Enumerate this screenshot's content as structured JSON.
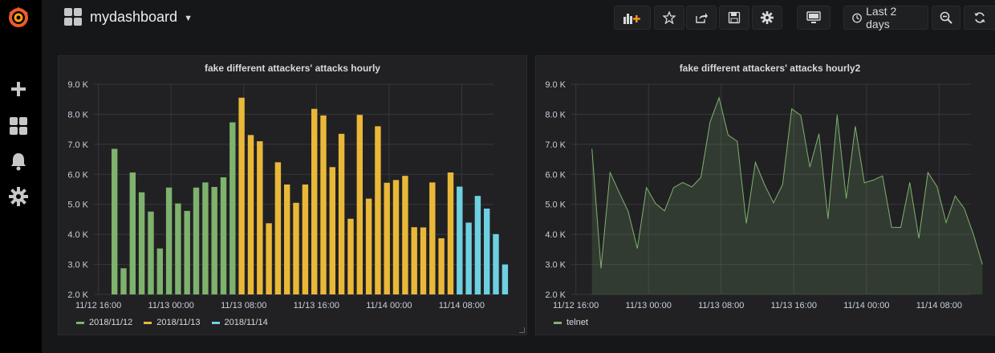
{
  "navbar": {
    "title": "mydashboard",
    "time_range_label": "Last 2 days"
  },
  "panels": [
    {
      "title": "fake different attackers' attacks hourly",
      "legend": [
        {
          "label": "2018/11/12",
          "color": "#7eb26d"
        },
        {
          "label": "2018/11/13",
          "color": "#eab839"
        },
        {
          "label": "2018/11/14",
          "color": "#6ed0e0"
        }
      ]
    },
    {
      "title": "fake different attackers' attacks hourly2",
      "legend": [
        {
          "label": "telnet",
          "color": "#7eb26d"
        }
      ]
    }
  ],
  "chart_data": [
    {
      "type": "bar",
      "title": "fake different attackers' attacks hourly",
      "x_tick_labels": [
        "11/12 16:00",
        "11/13 00:00",
        "11/13 08:00",
        "11/13 16:00",
        "11/14 00:00",
        "11/14 08:00"
      ],
      "y_tick_labels": [
        "2.0 K",
        "3.0 K",
        "4.0 K",
        "5.0 K",
        "6.0 K",
        "7.0 K",
        "8.0 K",
        "9.0 K"
      ],
      "ylim": [
        2000,
        9000
      ],
      "grid": true,
      "legend_position": "bottom-left",
      "series": [
        {
          "name": "2018/11/12",
          "color": "#7eb26d",
          "start_index": 0,
          "values": [
            6850,
            2870,
            6060,
            5400,
            4760,
            3530,
            5560,
            5030,
            4780,
            5560,
            5730,
            5580,
            5900,
            7730
          ]
        },
        {
          "name": "2018/11/13",
          "color": "#eab839",
          "start_index": 14,
          "values": [
            8550,
            7310,
            7100,
            4370,
            6400,
            5660,
            5050,
            5660,
            8180,
            7960,
            6240,
            7350,
            4520,
            7980,
            5190,
            7600,
            5720,
            5810,
            5950,
            4240,
            4230,
            5730,
            3870,
            6060
          ]
        },
        {
          "name": "2018/11/14",
          "color": "#6ed0e0",
          "start_index": 38,
          "values": [
            5590,
            4390,
            5280,
            4860,
            4010,
            3000
          ]
        }
      ]
    },
    {
      "type": "area",
      "title": "fake different attackers' attacks hourly2",
      "x_tick_labels": [
        "11/12 16:00",
        "11/13 00:00",
        "11/13 08:00",
        "11/13 16:00",
        "11/14 00:00",
        "11/14 08:00"
      ],
      "y_tick_labels": [
        "2.0 K",
        "3.0 K",
        "4.0 K",
        "5.0 K",
        "6.0 K",
        "7.0 K",
        "8.0 K",
        "9.0 K"
      ],
      "ylim": [
        2000,
        9000
      ],
      "grid": true,
      "legend_position": "bottom-left",
      "series": [
        {
          "name": "telnet",
          "color": "#7eb26d",
          "values": [
            6850,
            2870,
            6060,
            5400,
            4760,
            3530,
            5560,
            5030,
            4780,
            5560,
            5730,
            5580,
            5900,
            7730,
            8550,
            7310,
            7100,
            4370,
            6400,
            5660,
            5050,
            5660,
            8180,
            7960,
            6240,
            7350,
            4520,
            7980,
            5190,
            7600,
            5720,
            5810,
            5950,
            4240,
            4230,
            5730,
            3870,
            6060,
            5590,
            4390,
            5280,
            4860,
            4010,
            3000
          ]
        }
      ]
    }
  ]
}
